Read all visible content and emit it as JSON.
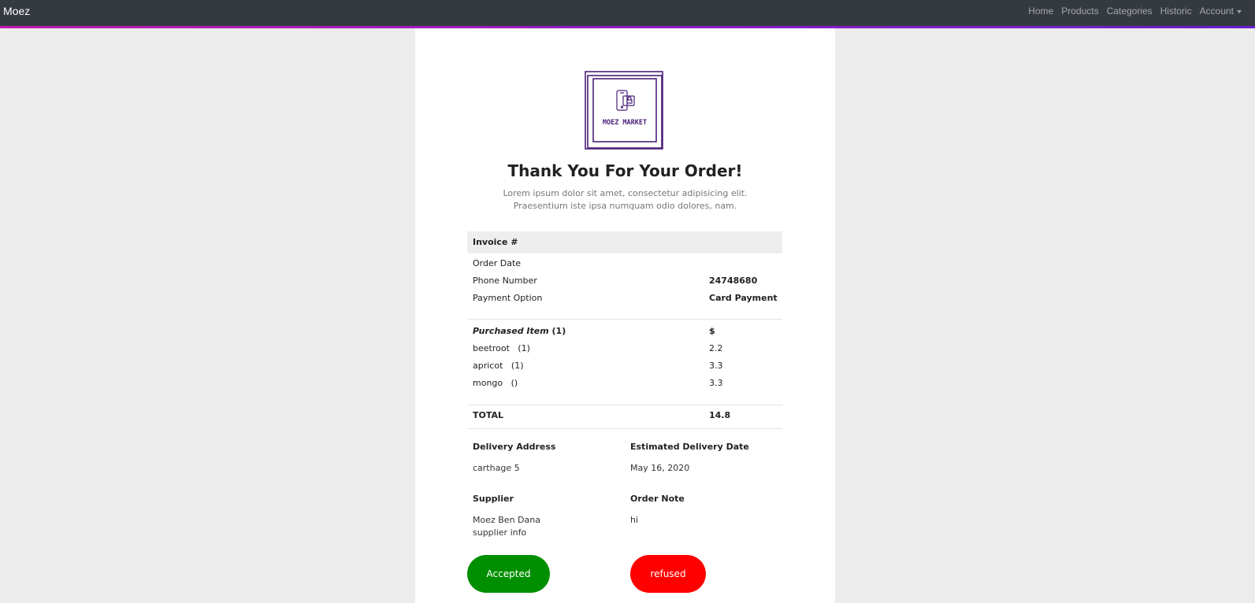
{
  "navbar": {
    "brand": "Moez",
    "links": [
      "Home",
      "Products",
      "Categories",
      "Historic",
      "Account"
    ]
  },
  "logo": {
    "text": "MOEZ MARKET",
    "color": "#4a1f7a"
  },
  "header": {
    "title": "Thank You For Your Order!",
    "subtitle": "Lorem ipsum dolor sit amet, consectetur adipisicing elit. Praesentium iste ipsa numquam odio dolores, nam."
  },
  "invoice": {
    "title": "Invoice #",
    "info": [
      {
        "label": "Order Date",
        "value": ""
      },
      {
        "label": "Phone Number",
        "value": "24748680"
      },
      {
        "label": "Payment Option",
        "value": "Card Payment"
      }
    ],
    "items_header": {
      "label_italic": "Purchased Item",
      "label_count": "(1)",
      "value": "$"
    },
    "items": [
      {
        "name": "beetroot",
        "qty": "(1)",
        "price": "2.2"
      },
      {
        "name": "apricot",
        "qty": "(1)",
        "price": "3.3"
      },
      {
        "name": "mongo",
        "qty": "()",
        "price": "3.3"
      }
    ],
    "total_label": "TOTAL",
    "total_value": "14.8"
  },
  "details": {
    "delivery_address_label": "Delivery Address",
    "delivery_address": "carthage 5",
    "estimated_date_label": "Estimated Delivery Date",
    "estimated_date": "May 16, 2020",
    "supplier_label": "Supplier",
    "supplier_name": "Moez Ben Dana",
    "supplier_info": "supplier info",
    "order_note_label": "Order Note",
    "order_note": "hi"
  },
  "actions": {
    "accept_label": "Accepted",
    "accept_color": "#008f00",
    "refuse_label": "refused",
    "refuse_color": "#ff0000"
  }
}
